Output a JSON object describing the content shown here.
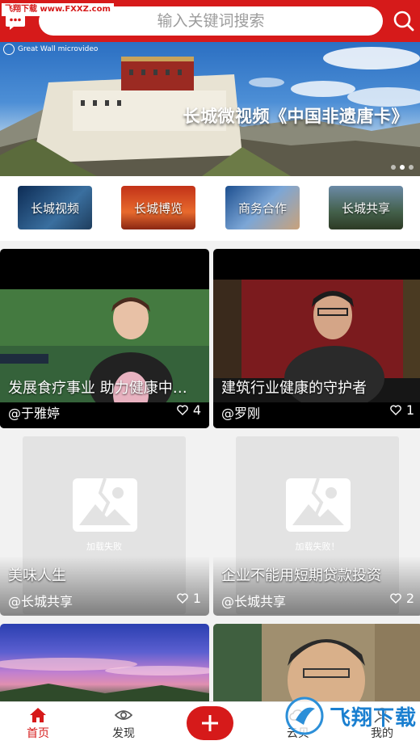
{
  "watermark": "飞翔下载 www.FXXZ.com",
  "search": {
    "placeholder": "输入关键词搜索"
  },
  "banner": {
    "logo_text": "Great Wall microvideo",
    "caption": "长城微视频《中国非遗唐卡》",
    "dots": 3,
    "active_dot": 1
  },
  "categories": [
    {
      "label": "长城视频"
    },
    {
      "label": "长城博览"
    },
    {
      "label": "商务合作"
    },
    {
      "label": "长城共享"
    }
  ],
  "videos": [
    {
      "title": "发展食疗事业  助力健康中…",
      "author": "@于雅婷",
      "likes": "4"
    },
    {
      "title": "建筑行业健康的守护者",
      "author": "@罗刚",
      "likes": "1"
    },
    {
      "title": "美味人生",
      "author": "@长城共享",
      "likes": "1",
      "placeholder": "加载失败"
    },
    {
      "title": "企业不能用短期贷款投资",
      "author": "@长城共享",
      "likes": "2",
      "placeholder": "加载失败！"
    }
  ],
  "nav": {
    "home": "首页",
    "discover": "发现",
    "cloud": "云贝",
    "me": "我的"
  },
  "watermark_bottom": "飞翔下载",
  "colors": {
    "accent": "#d61a1a"
  }
}
